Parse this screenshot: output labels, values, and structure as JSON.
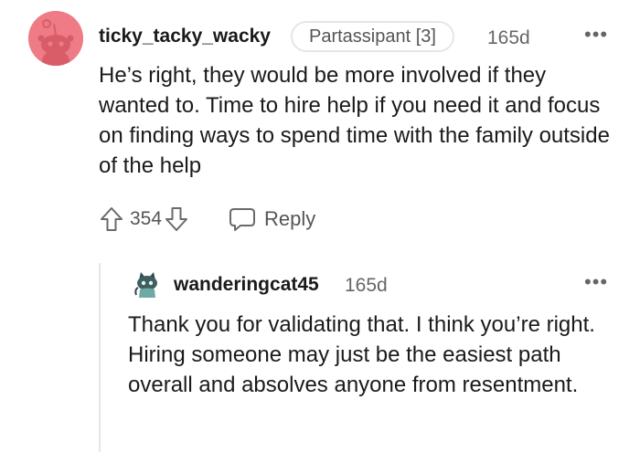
{
  "comment": {
    "username": "ticky_tacky_wacky",
    "flair": "Partassipant [3]",
    "age": "165d",
    "more_label": "•••",
    "body": "He’s right, they would be more involved if they wanted to. Time to hire help if you need it and focus on finding ways to spend time with the family outside of the help",
    "score": "354",
    "reply_label": "Reply",
    "avatar_color": "#ee7b85"
  },
  "reply": {
    "username": "wanderingcat45",
    "age": "165d",
    "more_label": "•••",
    "body": "Thank you for validating that. I think you’re right. Hiring someone may just be the easiest path overall and absolves anyone from resentment."
  }
}
